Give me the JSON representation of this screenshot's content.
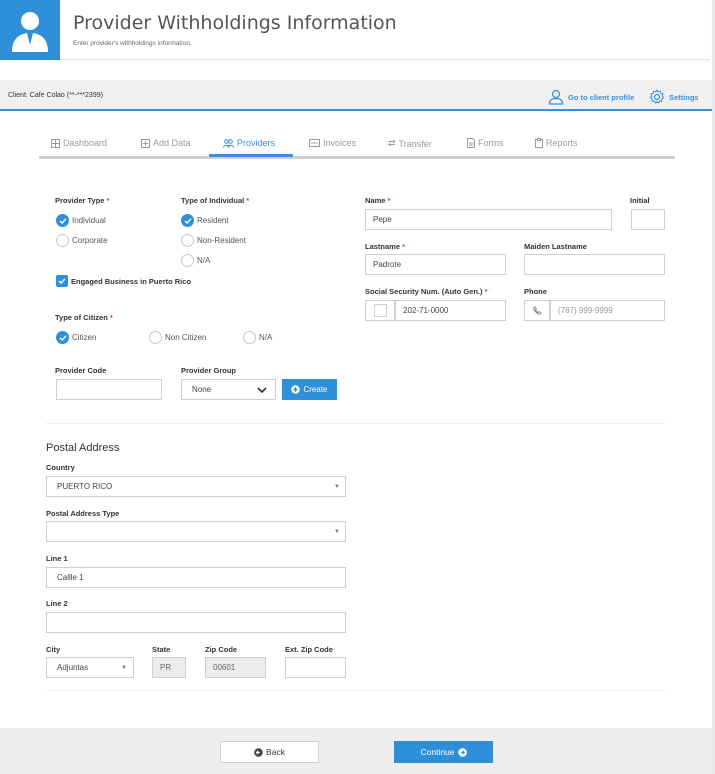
{
  "header": {
    "title": "Provider Withholdings Information",
    "subtitle": "Enter provider's withholdings information."
  },
  "client_bar": {
    "client": "Client: Cafe Colao (**-***2399)",
    "profile_link": "Go to client profile",
    "settings_link": "Settings"
  },
  "tabs": [
    {
      "label": "Dashboard",
      "icon": "dashboard-icon"
    },
    {
      "label": "Add Data",
      "icon": "plus-square-icon"
    },
    {
      "label": "Providers",
      "icon": "users-icon",
      "active": true
    },
    {
      "label": "Invoices",
      "icon": "invoice-icon"
    },
    {
      "label": "Transfer",
      "icon": "exchange-icon"
    },
    {
      "label": "Forms",
      "icon": "file-icon"
    },
    {
      "label": "Reports",
      "icon": "clipboard-icon"
    }
  ],
  "form": {
    "provider_type": {
      "label": "Provider Type",
      "options": [
        "Individual",
        "Corporate"
      ],
      "selected": "Individual"
    },
    "type_of_individual": {
      "label": "Type of Individual",
      "options": [
        "Resident",
        "Non-Resident",
        "N/A"
      ],
      "selected": "Resident"
    },
    "engaged_business": {
      "label": "Engaged Business in Puerto Rico",
      "checked": true
    },
    "type_of_citizen": {
      "label": "Type of Citizen",
      "options": [
        "Citizen",
        "Non Citizen",
        "N/A"
      ],
      "selected": "Citizen"
    },
    "provider_code": {
      "label": "Provider Code",
      "value": ""
    },
    "provider_group": {
      "label": "Provider Group",
      "value": "None"
    },
    "create_button": "Create",
    "name": {
      "label": "Name",
      "value": "Pepe"
    },
    "initial": {
      "label": "Initial",
      "value": ""
    },
    "lastname": {
      "label": "Lastname",
      "value": "Padrote"
    },
    "maiden_lastname": {
      "label": "Maiden Lastname",
      "value": ""
    },
    "ssn": {
      "label": "Social Security Num. (Auto Gen.)",
      "value": "202-71-0000"
    },
    "phone": {
      "label": "Phone",
      "placeholder": "(787) 999-9999"
    },
    "required_mark": "*"
  },
  "postal": {
    "title": "Postal Address",
    "country": {
      "label": "Country",
      "value": "PUERTO RICO"
    },
    "address_type": {
      "label": "Postal Address Type",
      "value": ""
    },
    "line1": {
      "label": "Line 1",
      "value": "Callle 1"
    },
    "line2": {
      "label": "Line 2",
      "value": ""
    },
    "city": {
      "label": "City",
      "value": "Adjuntas"
    },
    "state": {
      "label": "State",
      "value": "PR"
    },
    "zip": {
      "label": "Zip Code",
      "value": "00601"
    },
    "ext_zip": {
      "label": "Ext. Zip Code",
      "value": ""
    }
  },
  "footer": {
    "back": "Back",
    "continue": "Continue"
  },
  "colors": {
    "accent": "#2f8fd8",
    "required": "#e53935"
  }
}
